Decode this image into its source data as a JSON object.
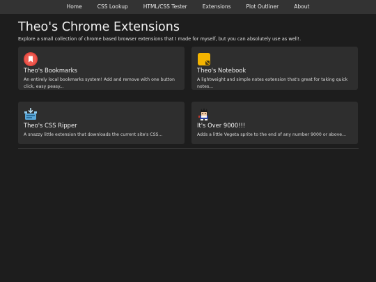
{
  "nav": {
    "items": [
      "Home",
      "CSS Lookup",
      "HTML/CSS Tester",
      "Extensions",
      "Plot Outliner",
      "About"
    ]
  },
  "header": {
    "title": "Theo's Chrome Extensions",
    "subtitle": "Explore a small collection of chrome based browser extensions that I made for myself, but you can absolutely use as well!."
  },
  "cards": [
    {
      "name": "Theo's Bookmarks",
      "description": "An entirely local bookmarks system! Add and remove with one button click, easy peasy...",
      "icon": "bookmark-icon"
    },
    {
      "name": "Theo's Notebook",
      "description": "A lightweight and simple notes extension that's great for taking quick notes...",
      "icon": "notebook-icon"
    },
    {
      "name": "Theo's CSS Ripper",
      "description": "A snazzy little extension that downloads the current site's CSS...",
      "icon": "css-ripper-icon"
    },
    {
      "name": "It's Over 9000!!!",
      "description": "Adds a little Vegeta sprite to the end of any number 9000 or above...",
      "icon": "vegeta-sprite-icon"
    }
  ],
  "colors": {
    "background": "#1d1d1d",
    "nav": "#333333",
    "card": "#2e2e2e",
    "bookmark_red": "#e5463f",
    "notebook_yellow": "#f4b400",
    "css_blue": "#5aa7d8"
  }
}
